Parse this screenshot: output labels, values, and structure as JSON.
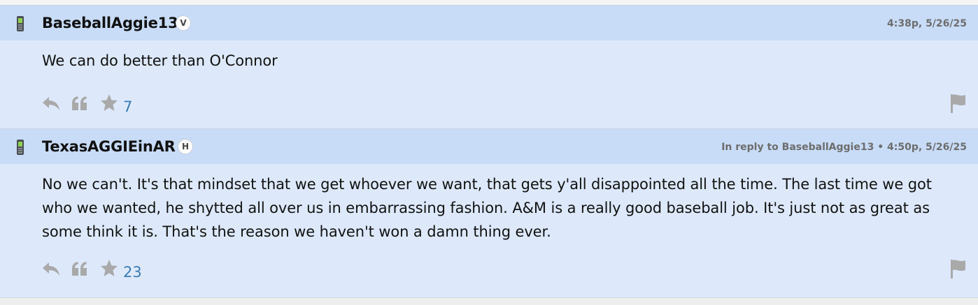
{
  "posts": [
    {
      "username": "BaseballAggie13",
      "badge": "V",
      "meta": "4:38p, 5/26/25",
      "body": "We can do better than O'Connor",
      "likes": "7"
    },
    {
      "username": "TexasAGGIEinAR",
      "badge": "H",
      "meta": "In reply to BaseballAggie13 • 4:50p, 5/26/25",
      "body": "No we can't. It's that mindset that we get whoever we want, that gets y'all disappointed all the time. The last time we got who we wanted, he shytted all over us in embarrassing fashion. A&M is a really good baseball job. It's just not as great as some think it is. That's the reason we haven't won a damn thing ever.",
      "likes": "23"
    }
  ],
  "icons": {
    "device": "phone-icon",
    "reply": "reply-icon",
    "quote": "quote-icon",
    "like": "star-icon",
    "report": "flag-icon"
  },
  "colors": {
    "post_bg": "#dde9fb",
    "header_bg": "#c8dcf7",
    "icon_gray": "#a9a9a9",
    "count_blue": "#3a7bb5"
  }
}
